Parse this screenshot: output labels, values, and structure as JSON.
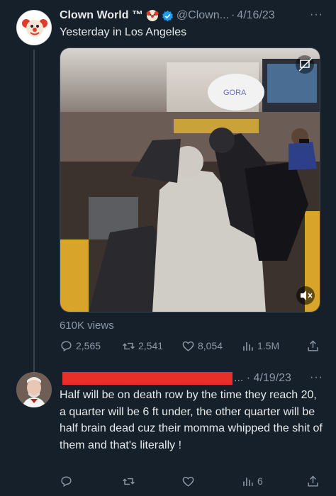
{
  "tweet": {
    "author_name": "Clown World ™",
    "author_handle": "@Clown...",
    "separator": "·",
    "date": "4/16/23",
    "more": "···",
    "text": "Yesterday in Los Angeles",
    "media_store_sign": "GORA",
    "views": "610K views",
    "actions": {
      "replies": "2,565",
      "retweets": "2,541",
      "likes": "8,054",
      "views": "1.5M"
    }
  },
  "reply": {
    "meta": "... · 4/19/23",
    "more": "···",
    "text": "Half will be on death row by the time they reach 20, a quarter will be 6 ft under, the other quarter will be half brain dead cuz their momma whipped the shit of them and that's literally !",
    "actions": {
      "views": "6"
    }
  },
  "colors": {
    "background": "#15202b",
    "muted": "#8b98a5",
    "verified": "#1d9bf0",
    "redaction": "#e8302a"
  }
}
